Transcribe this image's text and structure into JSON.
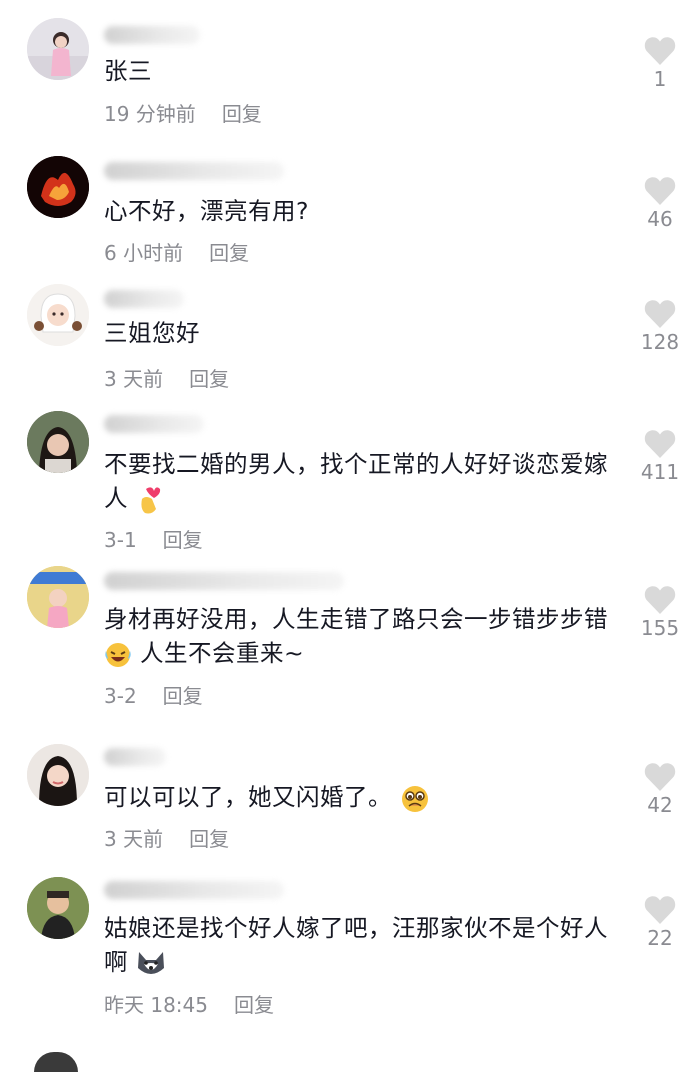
{
  "comments": [
    {
      "text": "张三",
      "time": "19 分钟前",
      "reply": "回复",
      "likes": "1"
    },
    {
      "text": "心不好，漂亮有用?",
      "time": "6 小时前",
      "reply": "回复",
      "likes": "46"
    },
    {
      "text": "三姐您好",
      "time": "3 天前",
      "reply": "回复",
      "likes": "128"
    },
    {
      "text": "不要找二婚的男人，找个正常的人好好谈恋爱嫁人",
      "emoji": "heart-fingers",
      "time": "3-1",
      "reply": "回复",
      "likes": "411"
    },
    {
      "text": "身材再好没用，人生走错了路只会一步错步步错",
      "emoji": "laughing-tears",
      "text2": "人生不会重来~",
      "time": "3-2",
      "reply": "回复",
      "likes": "155"
    },
    {
      "text": "可以可以了，她又闪婚了。",
      "emoji": "pleading-face",
      "time": "3 天前",
      "reply": "回复",
      "likes": "42"
    },
    {
      "text": "姑娘还是找个好人嫁了吧，汪那家伙不是个好人啊",
      "emoji": "husky-face",
      "time": "昨天 18:45",
      "reply": "回复",
      "likes": "22"
    }
  ],
  "colors": {
    "text": "#161823",
    "meta": "#8a8b91",
    "heart": "#d9d9d9"
  }
}
